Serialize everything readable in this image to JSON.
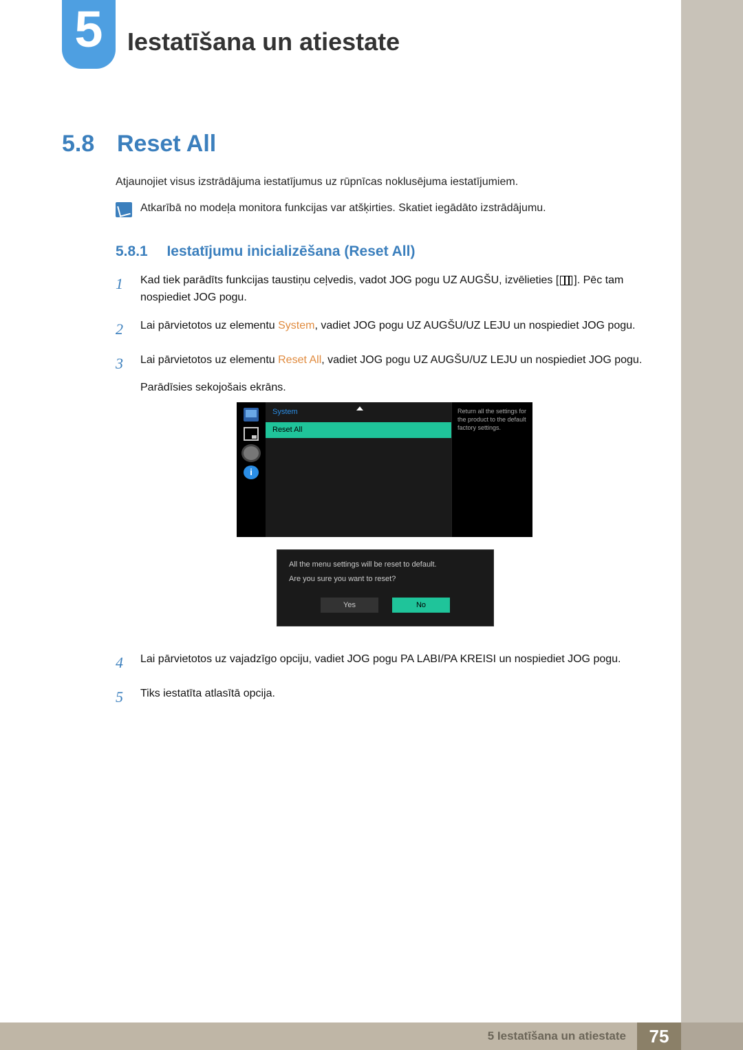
{
  "chapter": {
    "number": "5",
    "title": "Iestatīšana un atiestate"
  },
  "section": {
    "number": "5.8",
    "title": "Reset All"
  },
  "intro": "Atjaunojiet visus izstrādājuma iestatījumus uz rūpnīcas noklusējuma iestatījumiem.",
  "note": "Atkarībā no modeļa monitora funkcijas var atšķirties. Skatiet iegādāto izstrādājumu.",
  "subsection": {
    "number": "5.8.1",
    "title": "Iestatījumu inicializēšana (Reset All)"
  },
  "steps": [
    {
      "num": "1",
      "pre": "Kad tiek parādīts funkcijas taustiņu ceļvedis, vadot JOG pogu UZ AUGŠU, izvēlieties [",
      "post": "]. Pēc tam nospiediet JOG pogu."
    },
    {
      "num": "2",
      "pre": "Lai pārvietotos uz elementu ",
      "bold": "System",
      "post": ", vadiet JOG pogu UZ AUGŠU/UZ LEJU un nospiediet JOG pogu."
    },
    {
      "num": "3",
      "pre": "Lai pārvietotos uz elementu ",
      "bold": "Reset All",
      "post": ", vadiet JOG pogu UZ AUGŠU/UZ LEJU un nospiediet JOG pogu.",
      "after": "Parādīsies sekojošais ekrāns."
    },
    {
      "num": "4",
      "text": "Lai pārvietotos uz vajadzīgo opciju, vadiet JOG pogu PA LABI/PA KREISI un nospiediet JOG pogu."
    },
    {
      "num": "5",
      "text": "Tiks iestatīta atlasītā opcija."
    }
  ],
  "osd": {
    "system_label": "System",
    "selected": "Reset All",
    "desc": "Return all the settings for the product to the default factory settings.",
    "info_glyph": "i",
    "dialog": {
      "line1": "All the menu settings will be reset to default.",
      "line2": "Are you sure you want to reset?",
      "yes": "Yes",
      "no": "No"
    }
  },
  "footer": {
    "text": "5 Iestatīšana un atiestate",
    "page": "75"
  }
}
